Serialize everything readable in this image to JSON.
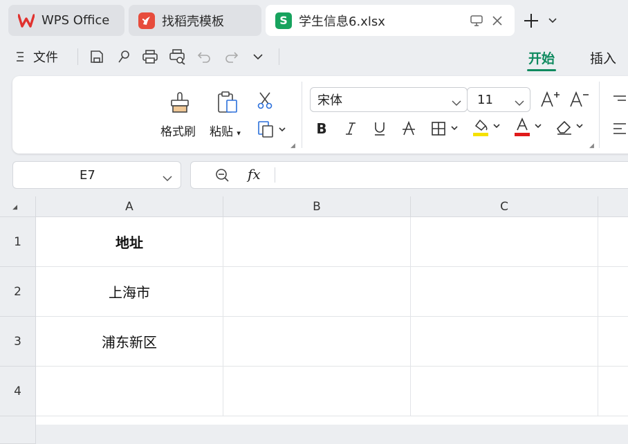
{
  "tabs": [
    {
      "label": "WPS Office",
      "icon": "wps-logo-icon"
    },
    {
      "label": "找稻壳模板",
      "icon": "docer-icon"
    },
    {
      "label": "学生信息6.xlsx",
      "icon": "spreadsheet-s-icon",
      "icon_letter": "S",
      "active": true
    }
  ],
  "toolbar": {
    "menu_label": "文件",
    "ribbon_tabs": [
      "开始",
      "插入"
    ],
    "active_ribbon_tab": "开始"
  },
  "ribbon": {
    "format_painter_label": "格式刷",
    "paste_label": "粘贴",
    "font_name": "宋体",
    "font_size": "11"
  },
  "formula_bar": {
    "cell_ref": "E7",
    "fx_label": "fx",
    "content": ""
  },
  "grid": {
    "columns": [
      "A",
      "B",
      "C"
    ],
    "rows": [
      {
        "num": "1",
        "cells": [
          "地址",
          "",
          ""
        ]
      },
      {
        "num": "2",
        "cells": [
          "上海市",
          "",
          ""
        ]
      },
      {
        "num": "3",
        "cells": [
          "浦东新区",
          "",
          ""
        ]
      },
      {
        "num": "4",
        "cells": [
          "",
          "",
          ""
        ]
      }
    ]
  },
  "colors": {
    "accent": "#0f8a5f",
    "wps_red": "#e0322f",
    "docer_red": "#e74c3c",
    "sheet_green": "#17a35e",
    "highlight_yellow": "#f5e100",
    "font_red": "#e01b1b"
  }
}
